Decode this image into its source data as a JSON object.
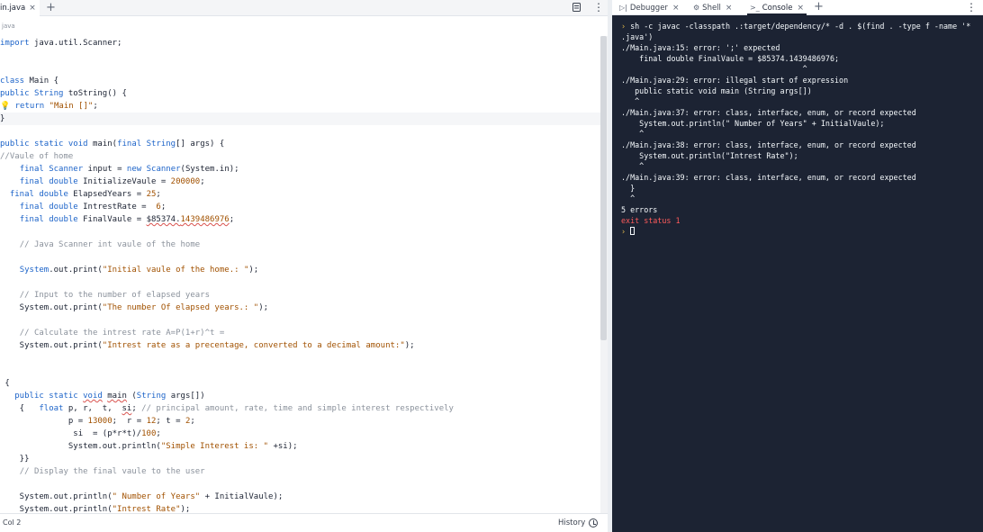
{
  "editor": {
    "tab": {
      "label": "in.java",
      "close": "×"
    },
    "add_tab": "+",
    "breadcrumb": "java",
    "status": {
      "position": "Col 2",
      "history": "History"
    }
  },
  "console": {
    "tabs": [
      {
        "icon": "▷|",
        "label": "Debugger",
        "close": "×"
      },
      {
        "icon": "⚙",
        "label": "Shell",
        "close": "×"
      },
      {
        "icon": ">_",
        "label": "Console",
        "close": "×"
      }
    ],
    "add_tab": "+",
    "command_prompt": "›",
    "command": " sh -c javac -classpath .:target/dependency/* -d . $(find . -type f -name '*",
    "command_cont": ".java')",
    "errors": [
      "./Main.java:15: error: ';' expected",
      "    final double FinalVaule = $85374.1439486976;",
      "                                        ^",
      "./Main.java:29: error: illegal start of expression",
      "   public static void main (String args[])",
      "   ^",
      "./Main.java:37: error: class, interface, enum, or record expected",
      "    System.out.println(\" Number of Years\" + InitialVaule);",
      "    ^",
      "./Main.java:38: error: class, interface, enum, or record expected",
      "    System.out.println(\"Intrest Rate\");",
      "    ^",
      "./Main.java:39: error: class, interface, enum, or record expected",
      "  }",
      "  ^"
    ],
    "summary": "5 errors",
    "exit_status": "exit status 1",
    "final_prompt": "›"
  }
}
